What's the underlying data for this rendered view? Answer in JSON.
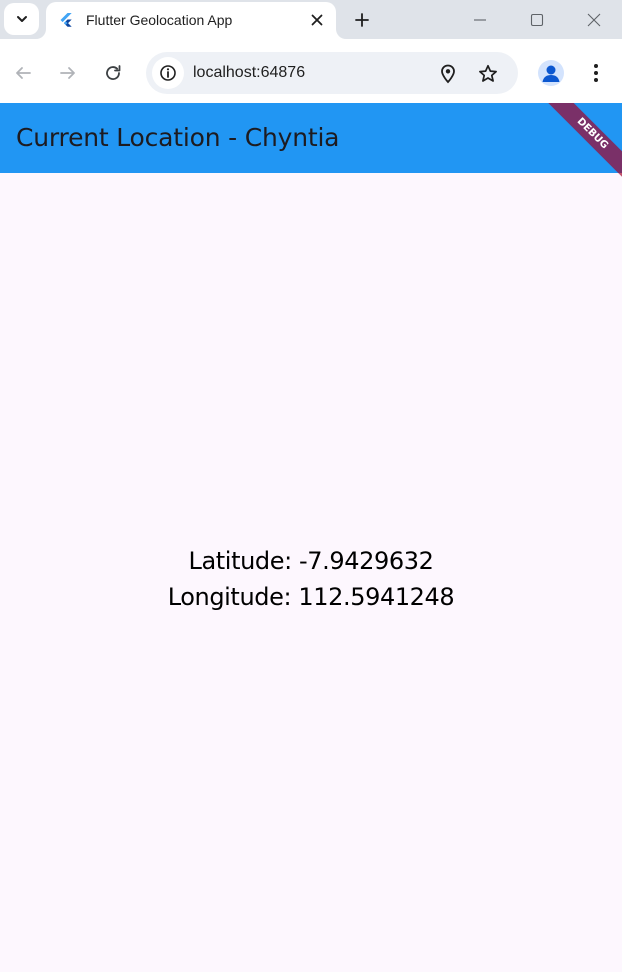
{
  "browser": {
    "tab": {
      "title": "Flutter Geolocation App"
    },
    "url": "localhost:64876"
  },
  "app": {
    "title": "Current Location - Chyntia",
    "debug_banner": "DEBUG",
    "latitude_text": "Latitude: -7.9429632",
    "longitude_text": "Longitude: 112.5941248",
    "colors": {
      "app_bar": "#2196f3",
      "background": "#fdf7fe",
      "title_text": "#1d1b20"
    }
  },
  "icons": {
    "tab_search": "chevron-down-icon",
    "favicon": "flutter-logo-icon",
    "tab_close": "close-icon",
    "new_tab": "plus-icon",
    "back": "arrow-left-icon",
    "forward": "arrow-right-icon",
    "reload": "reload-icon",
    "site_info": "info-icon",
    "location": "location-pin-icon",
    "bookmark": "star-icon",
    "profile": "person-icon",
    "menu": "kebab-menu-icon"
  }
}
